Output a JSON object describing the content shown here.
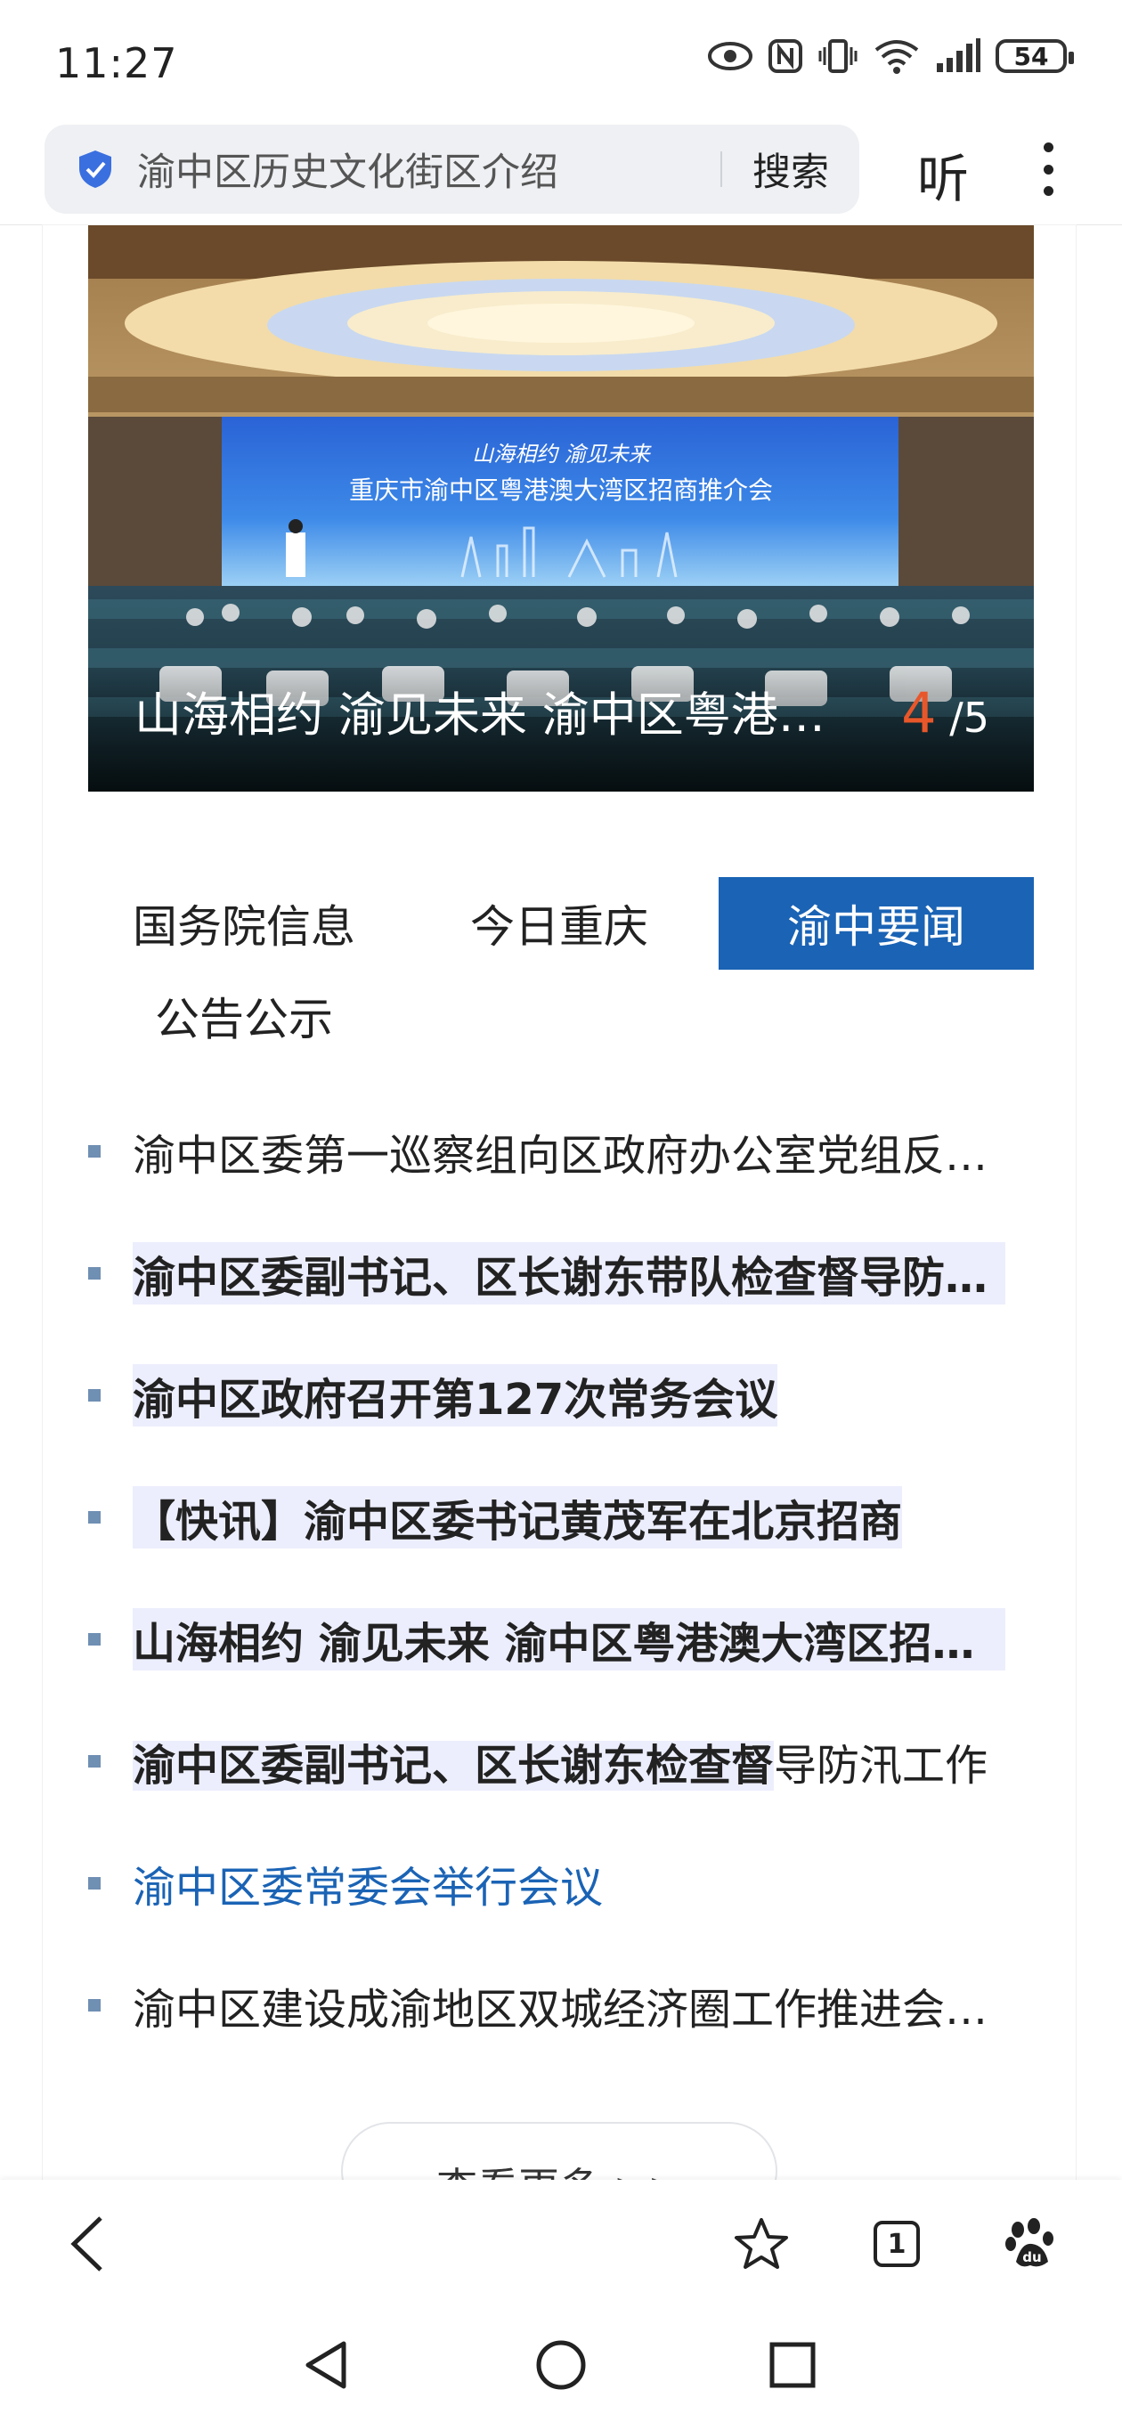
{
  "status_bar": {
    "time": "11:27",
    "battery": "54"
  },
  "address_bar": {
    "query": "渝中区历史文化街区介绍",
    "search_label": "搜索",
    "listen_label": "听"
  },
  "banner": {
    "caption": "山海相约 渝见未来 渝中区粤港澳大湾区招商推介会",
    "counter_current": "4",
    "counter_total": "/5",
    "screen_line1": "山海相约 渝见未来",
    "screen_line2": "重庆市渝中区粤港澳大湾区招商推介会"
  },
  "tabs": [
    {
      "label": "国务院信息",
      "active": false
    },
    {
      "label": "今日重庆",
      "active": false
    },
    {
      "label": "渝中要闻",
      "active": true
    },
    {
      "label": "公告公示",
      "active": false
    }
  ],
  "news": [
    {
      "title": "渝中区委第一巡察组向区政府办公室党组反馈巡察情况",
      "style": "normal"
    },
    {
      "title": "渝中区委副书记、区长谢东带队检查督导防汛工作",
      "style": "bold-hl"
    },
    {
      "title": "渝中区政府召开第127次常务会议",
      "style": "bold-hl"
    },
    {
      "title": "【快讯】渝中区委书记黄茂军在北京招商",
      "style": "bold-hl"
    },
    {
      "title": "山海相约 渝见未来 渝中区粤港澳大湾区招商推介会",
      "style": "bold-hl"
    },
    {
      "title_bold": "渝中区委副书记、区长谢东检查督",
      "title_rest": "导防汛工作",
      "style": "mixed"
    },
    {
      "title": "渝中区委常委会举行会议",
      "style": "blue"
    },
    {
      "title": "渝中区建设成渝地区双城经济圈工作推进会召开",
      "style": "normal"
    }
  ],
  "more_label": "查看更多 >>",
  "toolbar": {
    "tab_count": "1",
    "icons": [
      "back-arrow-icon",
      "star-icon",
      "tabs-icon",
      "baidu-paw-icon"
    ]
  },
  "system_nav": {
    "icons": [
      "nav-back-icon",
      "nav-home-icon",
      "nav-recents-icon"
    ]
  },
  "colors": {
    "accent": "#1a63b5",
    "highlight": "#eceefd",
    "counter": "#e8572a"
  }
}
